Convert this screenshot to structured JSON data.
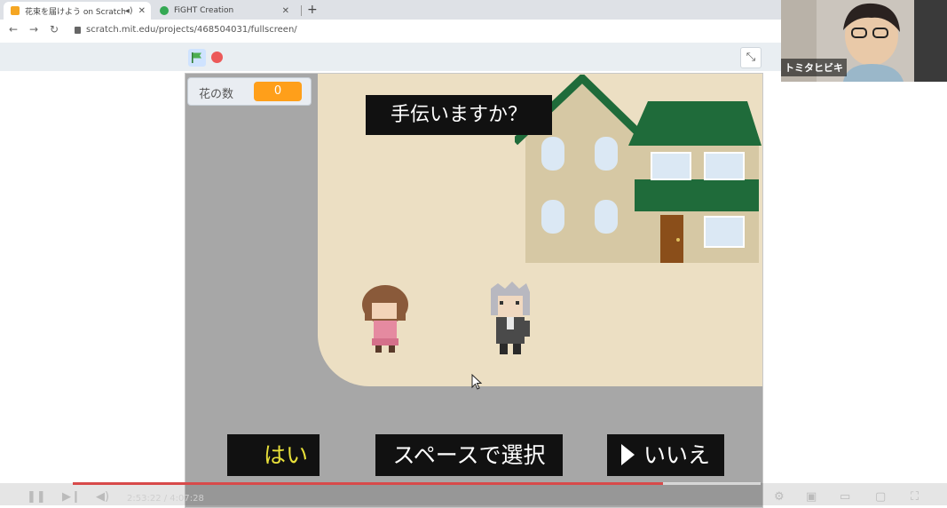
{
  "browser": {
    "tabs": [
      {
        "title": "花束を届けよう on Scratch",
        "active": true,
        "favicon_color": "#f5a623"
      },
      {
        "title": "FiGHT Creation",
        "active": false,
        "favicon_color": "#34a853"
      }
    ],
    "new_tab": "+",
    "url": "scratch.mit.edu/projects/468504031/fullscreen/"
  },
  "scratch": {
    "variable_monitor": {
      "name": "花の数",
      "value": "0"
    },
    "speech_bubble": "手伝いますか？",
    "choices": {
      "yes": "はい",
      "select": "スペースで選択",
      "no": "いいえ"
    },
    "colors": {
      "monitor_value": "#ff9f1a",
      "yes_text": "#e8e03a",
      "stage_road": "#a7a7a7",
      "stage_ground": "#ecdfc3",
      "roof": "#1f6b3a"
    }
  },
  "zoom": {
    "participant_name": "トミタヒビキ",
    "logo": "zoom"
  },
  "player": {
    "time": "2:53:22 / 4:07:28",
    "progress": 0.72
  }
}
